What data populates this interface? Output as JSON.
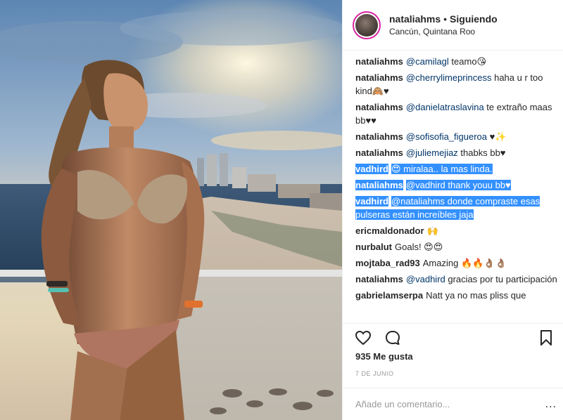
{
  "header": {
    "username": "nataliahms",
    "separator": "•",
    "follow_status": "Siguiendo",
    "location": "Cancún, Quintana Roo"
  },
  "comments": [
    {
      "user": "nataliahms",
      "mention": "@camilagl",
      "text": " teamo😘",
      "selected": false
    },
    {
      "user": "nataliahms",
      "mention": "@cherrylimeprincess",
      "text": " haha u r too kind🙈♥",
      "selected": false
    },
    {
      "user": "nataliahms",
      "mention": "@danielatraslavina",
      "text": " te extraño maas bb♥♥",
      "selected": false
    },
    {
      "user": "nataliahms",
      "mention": "@sofisofia_figueroa",
      "text": " ♥✨",
      "selected": false
    },
    {
      "user": "nataliahms",
      "mention": "@juliemejiaz",
      "text": " thabks bb♥",
      "selected": false
    },
    {
      "user": "vadhird",
      "mention": "",
      "text": "😍 miralaa.. la mas linda.",
      "selected": true
    },
    {
      "user": "nataliahms",
      "mention": "@vadhird",
      "text": " thank youu bb♥",
      "selected": true
    },
    {
      "user": "vadhird",
      "mention": "@nataliahms",
      "text": " donde compraste esas pulseras están increíbles jaja",
      "selected": true
    },
    {
      "user": "ericmaldonador",
      "mention": "",
      "text": "🙌",
      "selected": false
    },
    {
      "user": "nurbalut",
      "mention": "",
      "text": "Goals! 😍😍",
      "selected": false
    },
    {
      "user": "mojtaba_rad93",
      "mention": "",
      "text": "Amazing 🔥🔥👌🏽👌🏽",
      "selected": false
    },
    {
      "user": "nataliahms",
      "mention": "@vadhird",
      "text": " gracias por tu participación",
      "selected": false
    },
    {
      "user": "gabrielamserpa",
      "mention": "",
      "text": "Natt ya no mas pliss que",
      "selected": false
    }
  ],
  "actions": {
    "like_icon": "heart-icon",
    "comment_icon": "comment-bubble-icon",
    "save_icon": "bookmark-icon"
  },
  "likes_text": "935 Me gusta",
  "date_text": "7 DE JUNIO",
  "add_comment": {
    "placeholder": "Añade un comentario...",
    "value": "",
    "more_label": "..."
  }
}
